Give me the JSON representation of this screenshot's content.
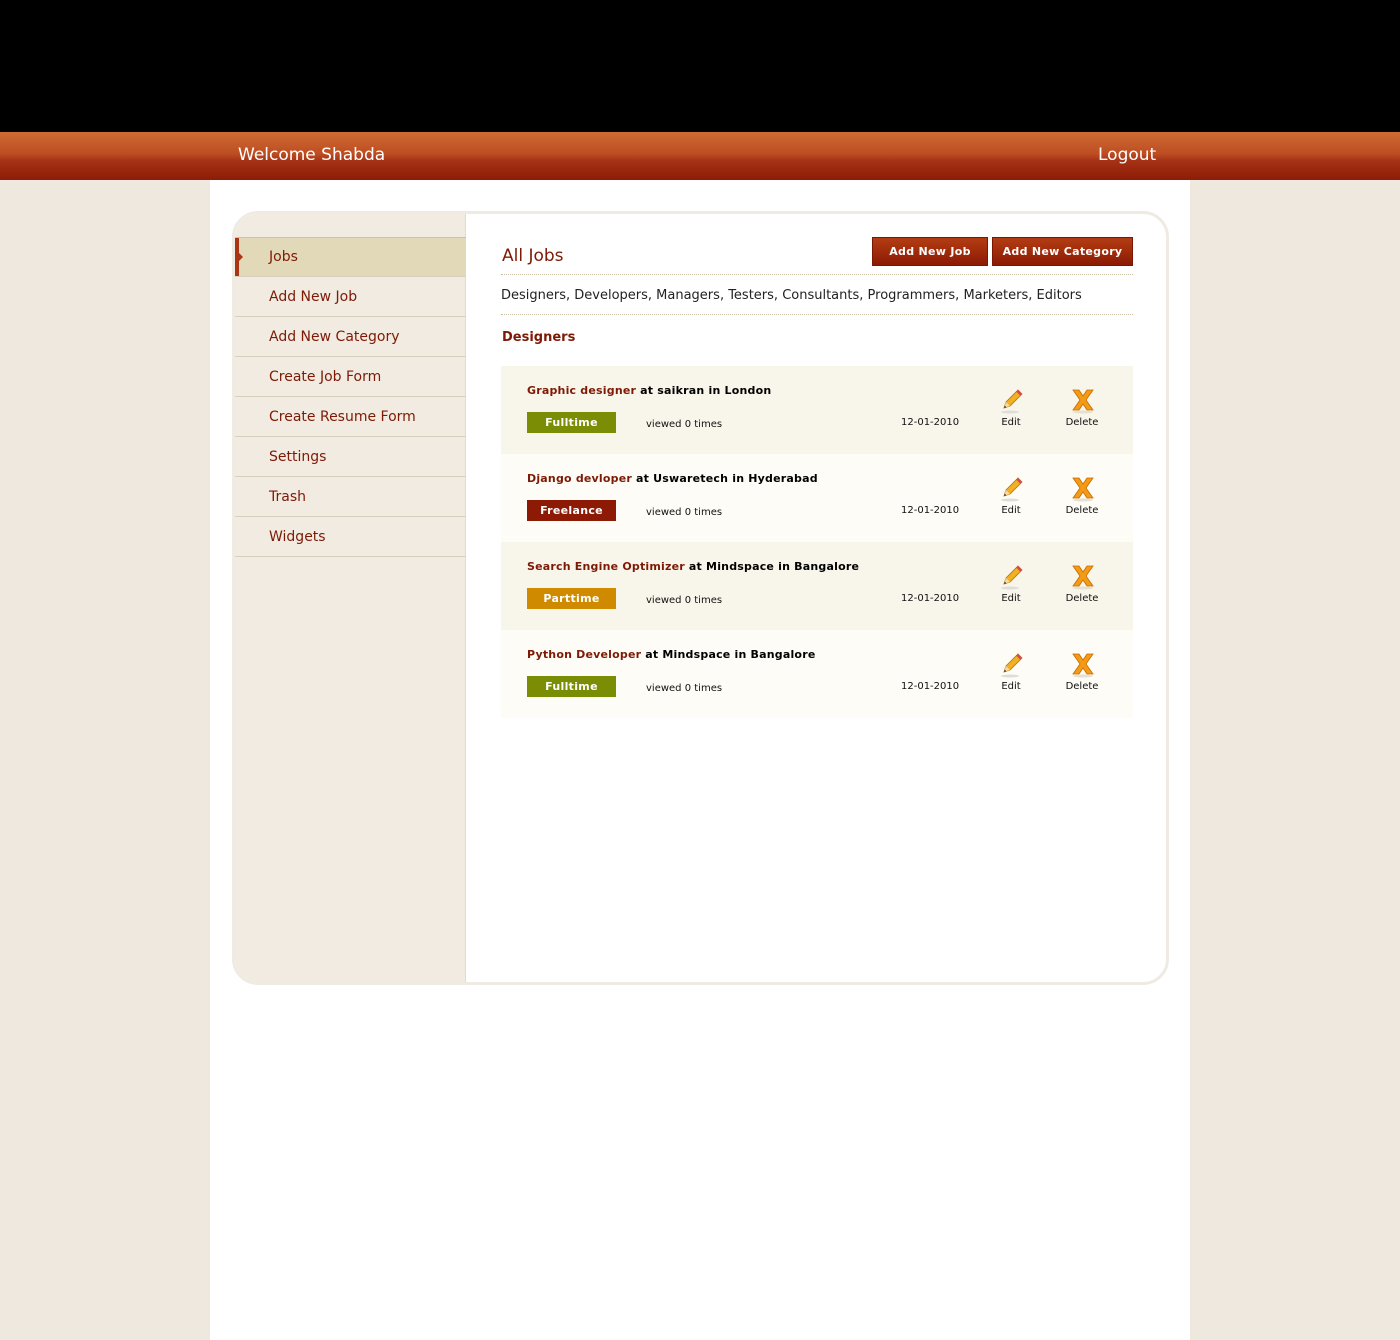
{
  "header": {
    "welcome": "Welcome Shabda",
    "logout": "Logout"
  },
  "sidebar": {
    "items": [
      {
        "label": "Jobs",
        "active": true
      },
      {
        "label": "Add New Job",
        "active": false
      },
      {
        "label": "Add New Category",
        "active": false
      },
      {
        "label": "Create Job Form",
        "active": false
      },
      {
        "label": "Create Resume Form",
        "active": false
      },
      {
        "label": "Settings",
        "active": false
      },
      {
        "label": "Trash",
        "active": false
      },
      {
        "label": "Widgets",
        "active": false
      }
    ]
  },
  "main": {
    "title": "All Jobs",
    "add_job_label": "Add New Job",
    "add_category_label": "Add New Category",
    "categories": [
      "Designers",
      "Developers",
      "Managers",
      "Testers",
      "Consultants",
      "Programmers",
      "Marketers",
      "Editors"
    ],
    "section_title": "Designers",
    "edit_label": "Edit",
    "delete_label": "Delete",
    "jobs": [
      {
        "role": "Graphic designer",
        "company": "saikran",
        "location": "London",
        "type": "Fulltime",
        "type_color": "#7a8d05",
        "views": "viewed 0 times",
        "date": "12-01-2010"
      },
      {
        "role": "Django devloper",
        "company": "Uswaretech",
        "location": "Hyderabad",
        "type": "Freelance",
        "type_color": "#8c1a04",
        "views": "viewed 0 times",
        "date": "12-01-2010"
      },
      {
        "role": "Search Engine Optimizer",
        "company": "Mindspace",
        "location": "Bangalore",
        "type": "Parttime",
        "type_color": "#d08a00",
        "views": "viewed 0 times",
        "date": "12-01-2010"
      },
      {
        "role": "Python Developer",
        "company": "Mindspace",
        "location": "Bangalore",
        "type": "Fulltime",
        "type_color": "#7a8d05",
        "views": "viewed 0 times",
        "date": "12-01-2010"
      }
    ]
  },
  "icons": {
    "edit": "pencil-icon",
    "delete": "x-delete-icon"
  },
  "colors": {
    "accent": "#8c1a04",
    "sidebar_bg": "#f1ebe1",
    "page_bg": "#efe8de"
  }
}
